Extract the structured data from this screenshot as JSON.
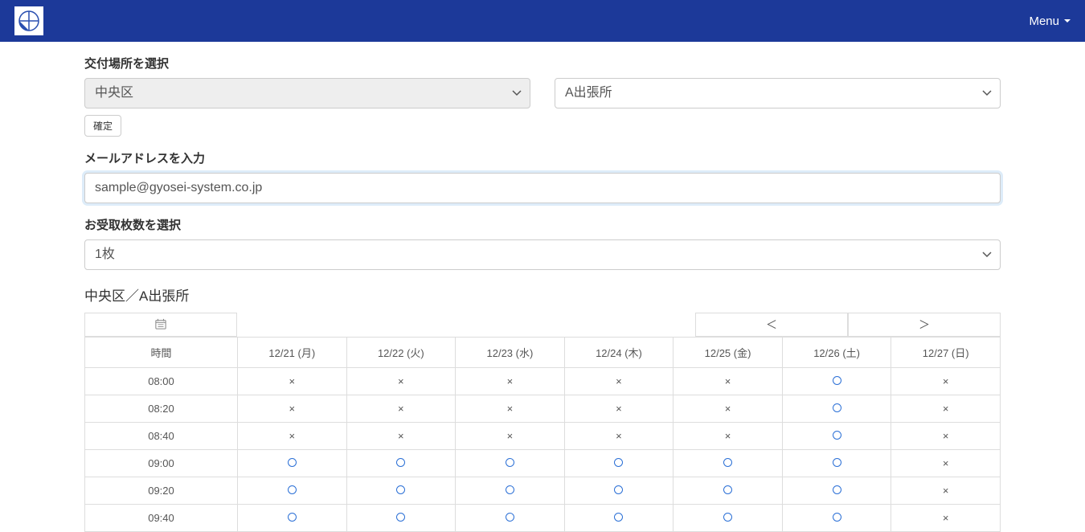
{
  "navbar": {
    "menu_label": "Menu"
  },
  "labels": {
    "location_select": "交付場所を選択",
    "email_input": "メールアドレスを入力",
    "quantity_select": "お受取枚数を選択",
    "confirm_button": "確定",
    "schedule_title": "中央区／A出張所",
    "time_header": "時間",
    "prev": "＜",
    "next": "＞"
  },
  "form": {
    "ward_value": "中央区",
    "office_value": "A出張所",
    "email_value": "sample@gyosei-system.co.jp",
    "quantity_value": "1枚"
  },
  "schedule": {
    "dates": [
      {
        "label": "12/21 (月)",
        "cls": ""
      },
      {
        "label": "12/22 (火)",
        "cls": ""
      },
      {
        "label": "12/23 (水)",
        "cls": ""
      },
      {
        "label": "12/24 (木)",
        "cls": ""
      },
      {
        "label": "12/25 (金)",
        "cls": ""
      },
      {
        "label": "12/26 (土)",
        "cls": "sat"
      },
      {
        "label": "12/27 (日)",
        "cls": "sun"
      }
    ],
    "rows": [
      {
        "time": "08:00",
        "slots": [
          "x",
          "x",
          "x",
          "x",
          "x",
          "o",
          "x"
        ]
      },
      {
        "time": "08:20",
        "slots": [
          "x",
          "x",
          "x",
          "x",
          "x",
          "o",
          "x"
        ]
      },
      {
        "time": "08:40",
        "slots": [
          "x",
          "x",
          "x",
          "x",
          "x",
          "o",
          "x"
        ]
      },
      {
        "time": "09:00",
        "slots": [
          "o",
          "o",
          "o",
          "o",
          "o",
          "o",
          "x"
        ]
      },
      {
        "time": "09:20",
        "slots": [
          "o",
          "o",
          "o",
          "o",
          "o",
          "o",
          "x"
        ]
      },
      {
        "time": "09:40",
        "slots": [
          "o",
          "o",
          "o",
          "o",
          "o",
          "o",
          "x"
        ],
        "truncated": true
      }
    ]
  }
}
